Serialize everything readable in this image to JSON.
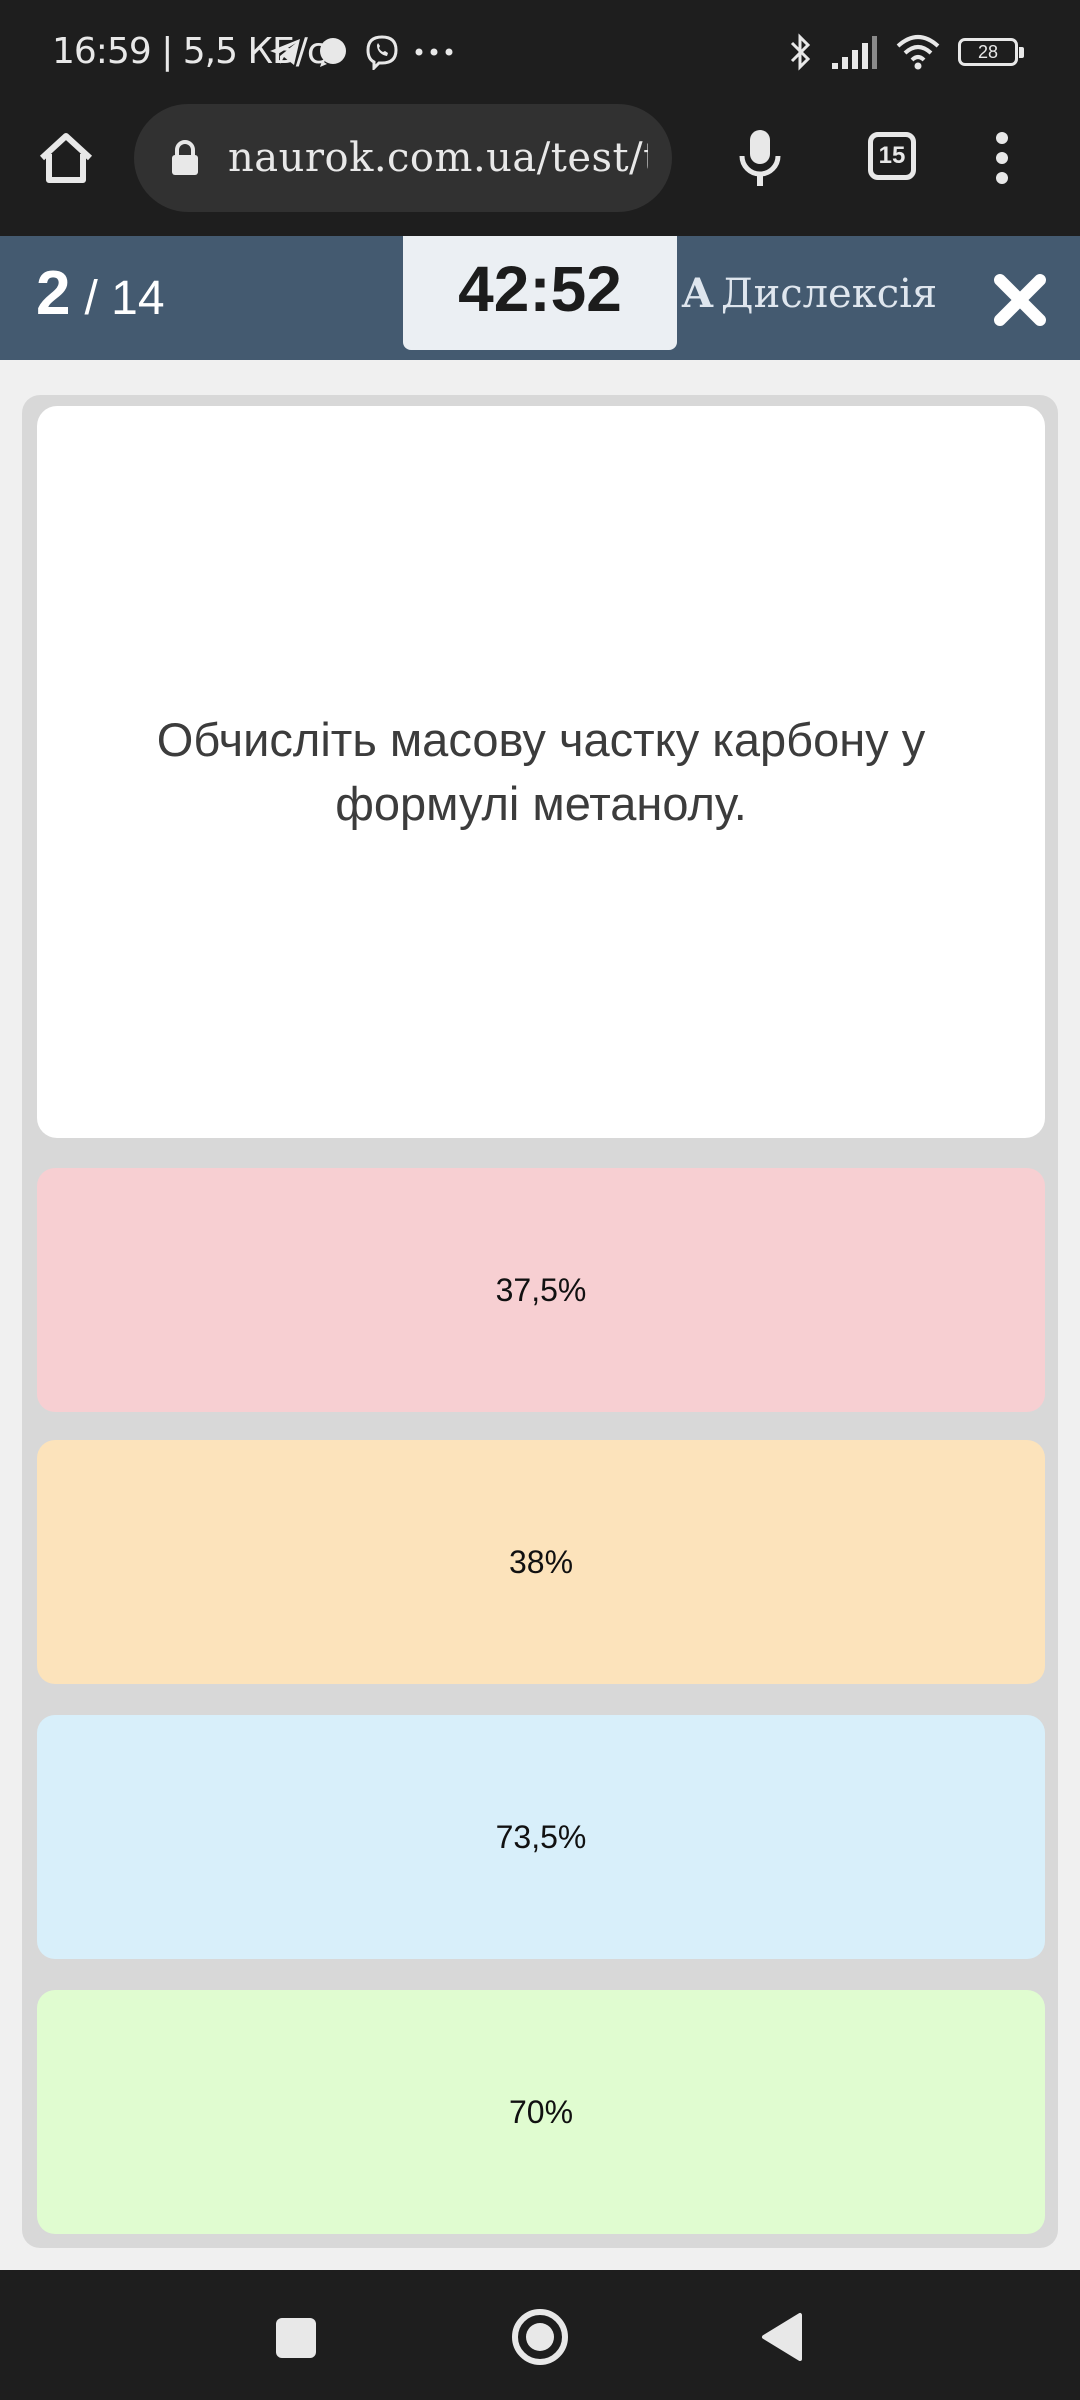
{
  "status_bar": {
    "time_and_speed": "16:59 | 5,5 КБ/с",
    "battery": "28",
    "app_icons": [
      "telegram-icon",
      "signal-icon",
      "viber-icon",
      "more-dots-icon"
    ],
    "system_icons": [
      "bluetooth-icon",
      "signal-strength-icon",
      "wifi-icon",
      "battery-icon"
    ]
  },
  "browser": {
    "url": "naurok.com.ua/test/test",
    "tab_count": "15",
    "icons": [
      "home-icon",
      "lock-icon",
      "mic-icon",
      "tabs-icon",
      "menu-icon"
    ]
  },
  "quiz_header": {
    "current": "2",
    "total": "/ 14",
    "timer": "42:52",
    "dyslexia_icon_letter": "A",
    "dyslexia_label": "Дислексія",
    "close_icon": "close-icon"
  },
  "question": {
    "text": "Обчисліть масову частку карбону у формулі метанолу."
  },
  "answers": [
    {
      "label": "37,5%",
      "color": "#f7cfd2"
    },
    {
      "label": "38%",
      "color": "#fce3bb"
    },
    {
      "label": "73,5%",
      "color": "#d8effa"
    },
    {
      "label": "70%",
      "color": "#e0fcd0"
    }
  ],
  "colors": {
    "header": "#445a70",
    "system_bar": "#1e1e1e"
  },
  "nav_bar": {
    "icons": [
      "recent-apps-icon",
      "home-circle-icon",
      "back-icon"
    ]
  }
}
